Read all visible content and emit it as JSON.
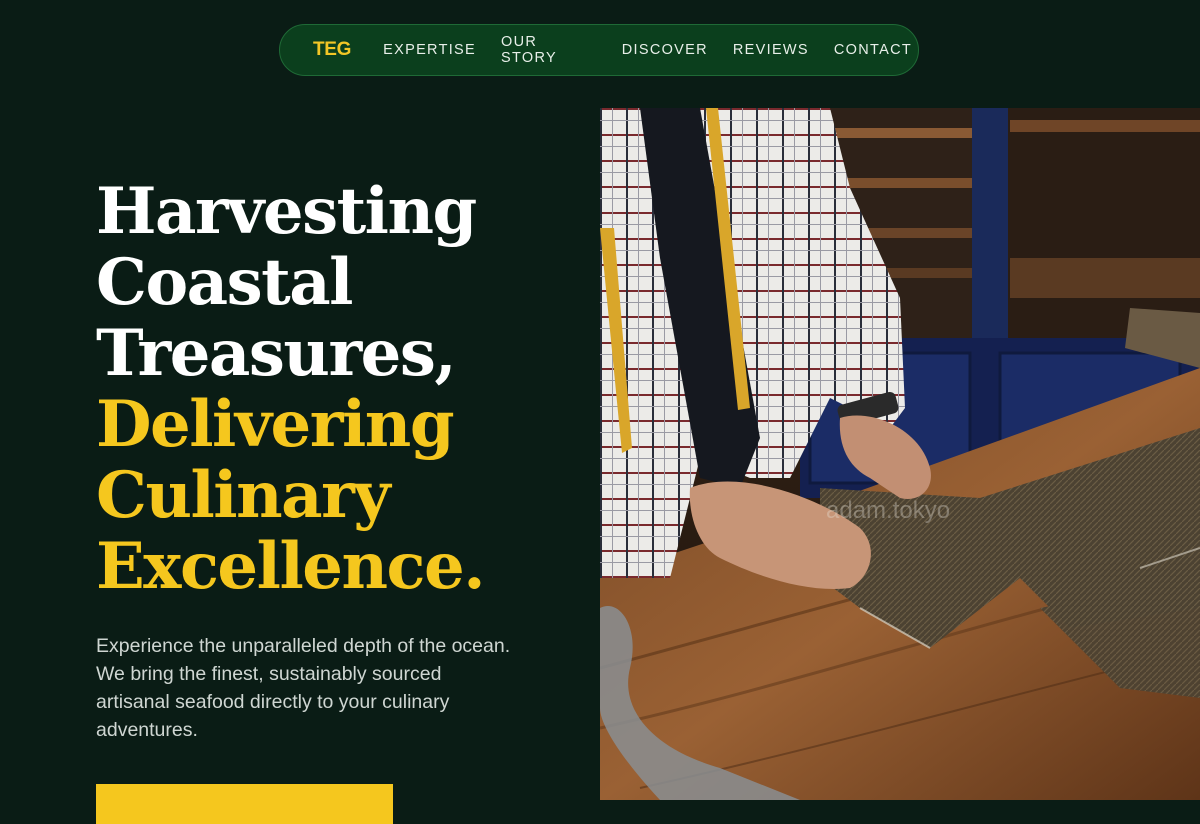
{
  "nav": {
    "logo": "TEG",
    "links": [
      "EXPERTISE",
      "OUR STORY",
      "DISCOVER",
      "REVIEWS",
      "CONTACT"
    ]
  },
  "hero": {
    "headline_white": [
      "Harvesting",
      "Coastal",
      "Treasures,"
    ],
    "headline_yellow": [
      "Delivering",
      "Culinary",
      "Excellence."
    ],
    "lead": "Experience the unparalleled depth of the ocean. We bring the finest, sustainably sourced artisanal seafood directly to your culinary adventures."
  },
  "photo": {
    "watermark": "adam.tokyo"
  },
  "colors": {
    "background": "#0a1c15",
    "nav_background": "#0b3f1d",
    "accent": "#f5c71e"
  }
}
